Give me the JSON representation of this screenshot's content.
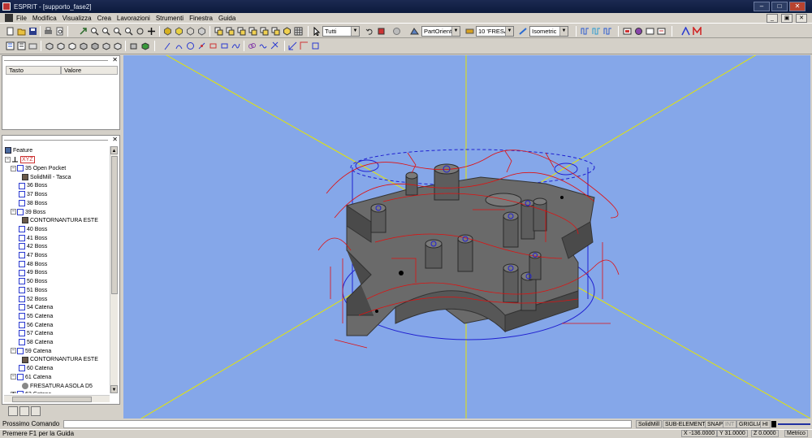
{
  "window": {
    "title": "ESPRIT - [supporto_fase2]"
  },
  "menu": {
    "items": [
      "File",
      "Modifica",
      "Visualizza",
      "Crea",
      "Lavorazioni",
      "Strumenti",
      "Finestra",
      "Guida"
    ]
  },
  "toolbar": {
    "select_filter": "Tutti",
    "part_orient": "PartOrient",
    "tool": "10 'FRESA'",
    "view": "Isometric"
  },
  "properties": {
    "columns": [
      "Tasto",
      "Valore"
    ]
  },
  "tree": {
    "root": "Feature",
    "xyz": "XYZ",
    "items": [
      {
        "label": "35 Open Pocket",
        "level": 1,
        "type": "feature",
        "expand": "minus"
      },
      {
        "label": "SolidMill - Tasca",
        "level": 2,
        "type": "operation"
      },
      {
        "label": "36 Boss",
        "level": 1,
        "type": "feature"
      },
      {
        "label": "37 Boss",
        "level": 1,
        "type": "feature"
      },
      {
        "label": "38 Boss",
        "level": 1,
        "type": "feature"
      },
      {
        "label": "39 Boss",
        "level": 1,
        "type": "feature",
        "expand": "minus"
      },
      {
        "label": "CONTORNANTURA ESTE",
        "level": 2,
        "type": "operation"
      },
      {
        "label": "40 Boss",
        "level": 1,
        "type": "feature"
      },
      {
        "label": "41 Boss",
        "level": 1,
        "type": "feature"
      },
      {
        "label": "42 Boss",
        "level": 1,
        "type": "feature"
      },
      {
        "label": "47 Boss",
        "level": 1,
        "type": "feature"
      },
      {
        "label": "48 Boss",
        "level": 1,
        "type": "feature"
      },
      {
        "label": "49 Boss",
        "level": 1,
        "type": "feature"
      },
      {
        "label": "50 Boss",
        "level": 1,
        "type": "feature"
      },
      {
        "label": "51 Boss",
        "level": 1,
        "type": "feature"
      },
      {
        "label": "52 Boss",
        "level": 1,
        "type": "feature"
      },
      {
        "label": "54 Catena",
        "level": 1,
        "type": "feature"
      },
      {
        "label": "55 Catena",
        "level": 1,
        "type": "feature"
      },
      {
        "label": "56 Catena",
        "level": 1,
        "type": "feature"
      },
      {
        "label": "57 Catena",
        "level": 1,
        "type": "feature"
      },
      {
        "label": "58 Catena",
        "level": 1,
        "type": "feature"
      },
      {
        "label": "59 Catena",
        "level": 1,
        "type": "feature",
        "expand": "minus"
      },
      {
        "label": "CONTORNANTURA ESTE",
        "level": 2,
        "type": "operation"
      },
      {
        "label": "60 Catena",
        "level": 1,
        "type": "feature"
      },
      {
        "label": "61 Catena",
        "level": 1,
        "type": "feature",
        "expand": "minus"
      },
      {
        "label": "FRESATURA ASOLA D5",
        "level": 2,
        "type": "drill"
      },
      {
        "label": "62 Catena",
        "level": 1,
        "type": "feature",
        "expand": "plus"
      }
    ]
  },
  "command": {
    "label": "Prossimo Comando",
    "value": ""
  },
  "status": {
    "message": "Premere F1 per la Guida",
    "indicators": [
      "SolidMill",
      "SUB-ELEMENTI",
      "SNAP",
      "INT",
      "GRIGLIA",
      "HI"
    ],
    "x": "X -136.0000",
    "y": "Y 31.0000",
    "z": "Z 0.0000",
    "units": "Metrico"
  },
  "colors": {
    "viewport_bg": "#85a7e9",
    "toolpath": "#e01010",
    "stock": "#2020d0",
    "axis": "#e6e600",
    "part": "#5a5a5a"
  }
}
